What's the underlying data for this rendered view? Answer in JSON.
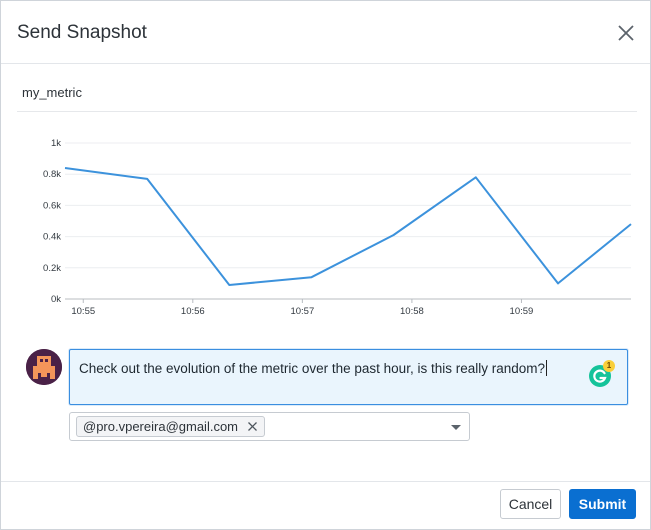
{
  "dialog": {
    "title": "Send Snapshot",
    "close_icon": "close-icon"
  },
  "metric": {
    "name": "my_metric"
  },
  "chart_data": {
    "type": "line",
    "title": "",
    "xlabel": "",
    "ylabel": "",
    "y_tick_labels": [
      "0k",
      "0.2k",
      "0.4k",
      "0.6k",
      "0.8k",
      "1k"
    ],
    "x_tick_labels": [
      "10:55",
      "10:56",
      "10:57",
      "10:58",
      "10:59"
    ],
    "ylim": [
      0,
      1000
    ],
    "grid": true,
    "series": [
      {
        "color": "#3c92dc",
        "x": [
          "10:54:50",
          "10:55:35",
          "10:56:20",
          "10:57:05",
          "10:57:50",
          "10:58:35",
          "10:59:20",
          "11:00:00"
        ],
        "values": [
          840,
          770,
          90,
          140,
          410,
          780,
          100,
          480
        ]
      }
    ]
  },
  "comment": {
    "avatar_icon": "avatar-icon",
    "text": "Check out the evolution of the metric over the past hour, is this really random?",
    "grammarly_icon": "grammarly-icon",
    "grammarly_count": "1"
  },
  "recipients": {
    "chips": [
      {
        "label": "@pro.vpereira@gmail.com"
      }
    ],
    "dropdown_icon": "chevron-down-icon"
  },
  "footer": {
    "cancel_label": "Cancel",
    "submit_label": "Submit"
  },
  "colors": {
    "accent": "#0a6fd1",
    "line": "#3c92dc",
    "input_highlight": "#eaf5fd"
  }
}
